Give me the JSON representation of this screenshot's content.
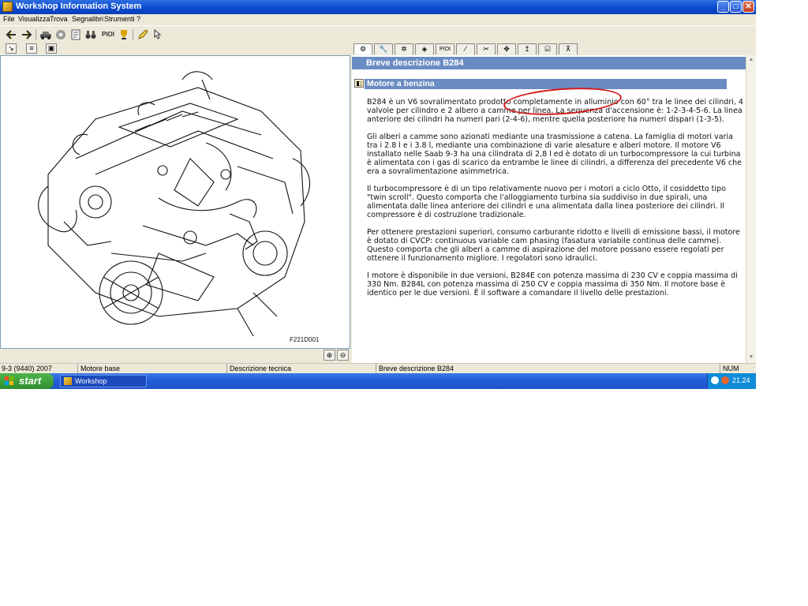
{
  "window": {
    "title": "Workshop Information System",
    "controls": {
      "minimize": "_",
      "maximize": "□",
      "close": "✕"
    }
  },
  "menu": [
    "File",
    "Visualizza",
    "Trova",
    "Segnalibri",
    "Strumenti",
    "?"
  ],
  "toolbar": {
    "icons": [
      "back-arrow-icon",
      "forward-arrow-icon",
      "car-icon",
      "parts-icon",
      "document-icon",
      "binoculars-icon",
      "trophy-icon",
      "pencil-icon",
      "pointer-icon"
    ],
    "pioi_label": "PIOI"
  },
  "image_panel": {
    "caption": "F221D001"
  },
  "tabs": {
    "pioi_label": "PIOI",
    "icons": [
      "engine-icon",
      "wrench-icon",
      "gears-icon",
      "component-icon",
      "pioi-tab",
      "tool-icon",
      "tools-icon",
      "move-icon",
      "lift-icon",
      "checklist-icon",
      "car-lift-icon"
    ]
  },
  "content": {
    "header": "Breve descrizione B284",
    "section_title": "Motore a benzina",
    "paragraphs": [
      "B284 è un V6 sovralimentato prodotto completamente in alluminio con 60° tra le linee dei cilindri, 4 valvole per cilindro e 2 albero a camme per linea. La sequenza d'accensione è: 1-2-3-4-5-6. La linea anteriore dei cilindri ha numeri pari (2-4-6), mentre quella posteriore ha numeri dispari (1-3-5).",
      "Gli alberi a camme sono azionati mediante una trasmissione a catena. La famiglia di motori varia tra i 2.8 l e i 3.8 l, mediante una combinazione di varie alesature e alberi motore. Il motore V6 installato nelle Saab 9-3 ha una cilindrata di 2,8 l ed è dotato di un turbocompressore la cui turbina è alimentata con i gas di scarico da entrambe le linee di cilindri, a differenza del precedente V6 che era a sovralimentazione asimmetrica.",
      "Il turbocompressore è di un tipo relativamente nuovo per i motori a ciclo Otto, il cosiddetto tipo \"twin scroll\". Questo comporta che l'alloggiamento turbina sia suddiviso in due spirali, una alimentata dalle linea anteriore dei cilindri e una alimentata dalla linea posteriore dei cilindri. Il compressore è di costruzione tradizionale.",
      "Per ottenere prestazioni superiori, consumo carburante ridotto e livelli di emissione bassi, il motore è dotato di CVCP: continuous variable cam phasing (fasatura variabile continua delle camme). Questo comporta che gli alberi a camme di aspirazione del motore possano essere regolati per ottenere il funzionamento migliore. I regolatori sono idraulici.",
      "I motore è disponibile in due versioni, B284E con potenza massima di 230 CV e coppia massima di 330 Nm. B284L con potenza massima di 250 CV e coppia massima di 350 Nm. Il motore base è identico per le due versioni. È il software a comandare il livello delle prestazioni."
    ]
  },
  "status": {
    "model": "9-3 (9440) 2007",
    "group": "Motore base",
    "type": "Descrizione tecnica",
    "doc": "Breve descrizione B284",
    "num": "NUM"
  },
  "taskbar": {
    "start": "start",
    "task": "Workshop Informatio...",
    "clock": "21.24"
  },
  "colors": {
    "header_bar": "#6b8cc2",
    "annotation": "#d21919",
    "taskbar": "#245edb",
    "start": "#3a9a37"
  }
}
